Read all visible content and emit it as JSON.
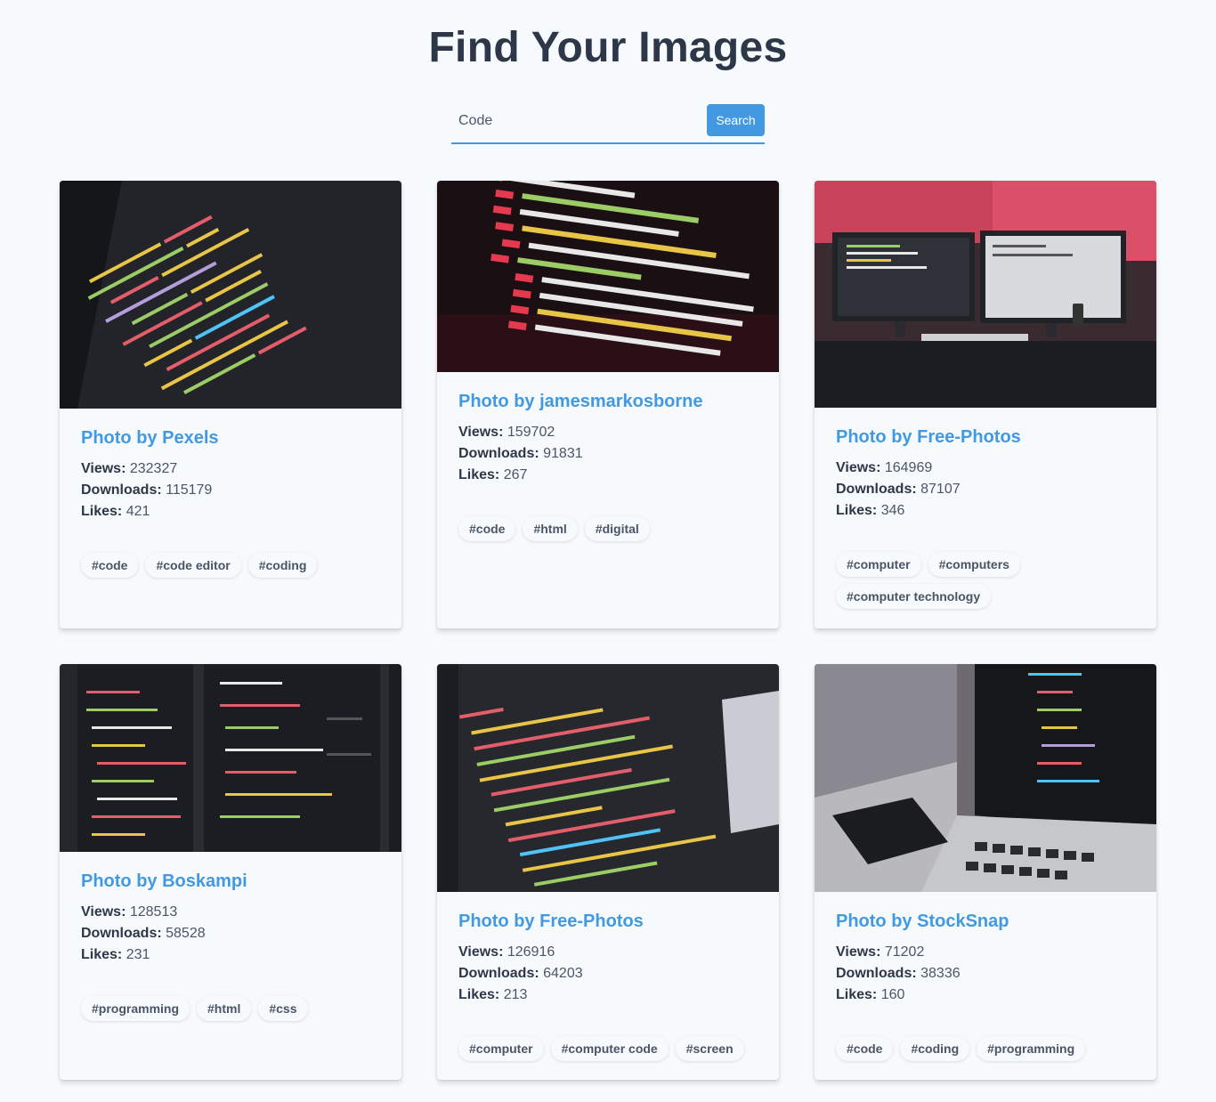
{
  "header": {
    "title": "Find Your Images"
  },
  "search": {
    "value": "Code",
    "button_label": "Search"
  },
  "cards": [
    {
      "title": "Photo by Pexels",
      "views_label": "Views:",
      "views": "232327",
      "downloads_label": "Downloads:",
      "downloads": "115179",
      "likes_label": "Likes:",
      "likes": "421",
      "tags": [
        "#code",
        "#code editor",
        "#coding"
      ]
    },
    {
      "title": "Photo by jamesmarkosborne",
      "views_label": "Views:",
      "views": "159702",
      "downloads_label": "Downloads:",
      "downloads": "91831",
      "likes_label": "Likes:",
      "likes": "267",
      "tags": [
        "#code",
        "#html",
        "#digital"
      ]
    },
    {
      "title": "Photo by Free-Photos",
      "views_label": "Views:",
      "views": "164969",
      "downloads_label": "Downloads:",
      "downloads": "87107",
      "likes_label": "Likes:",
      "likes": "346",
      "tags": [
        "#computer",
        "#computers",
        "#computer technology"
      ]
    },
    {
      "title": "Photo by Boskampi",
      "views_label": "Views:",
      "views": "128513",
      "downloads_label": "Downloads:",
      "downloads": "58528",
      "likes_label": "Likes:",
      "likes": "231",
      "tags": [
        "#programming",
        "#html",
        "#css"
      ]
    },
    {
      "title": "Photo by Free-Photos",
      "views_label": "Views:",
      "views": "126916",
      "downloads_label": "Downloads:",
      "downloads": "64203",
      "likes_label": "Likes:",
      "likes": "213",
      "tags": [
        "#computer",
        "#computer code",
        "#screen"
      ]
    },
    {
      "title": "Photo by StockSnap",
      "views_label": "Views:",
      "views": "71202",
      "downloads_label": "Downloads:",
      "downloads": "38336",
      "likes_label": "Likes:",
      "likes": "160",
      "tags": [
        "#code",
        "#coding",
        "#programming"
      ]
    }
  ],
  "colors": {
    "accent": "#4299e1",
    "text": "#2d3748",
    "background": "#f7fafc"
  }
}
